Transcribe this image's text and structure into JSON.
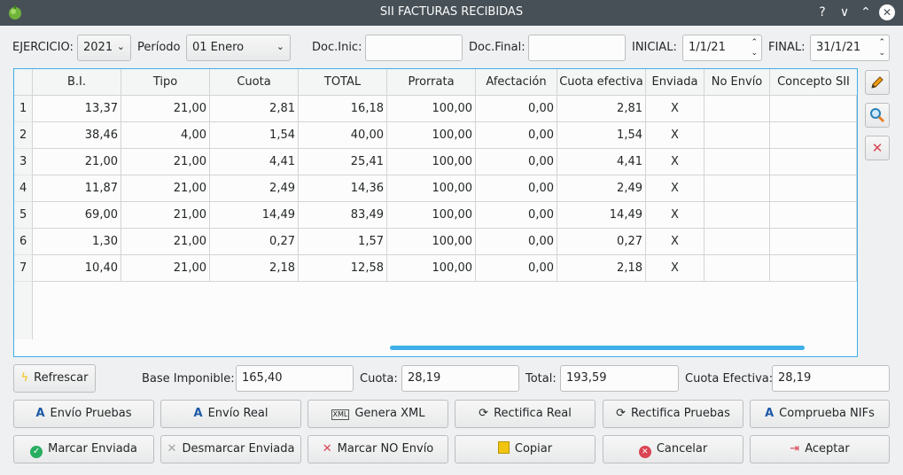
{
  "window": {
    "title": "SII FACTURAS RECIBIDAS",
    "help": "?",
    "minimize": "∨",
    "maximize": "⌃",
    "close": "✕"
  },
  "filters": {
    "ejercicio_label": "EJERCICIO:",
    "ejercicio_value": "2021",
    "periodo_label": "Período",
    "periodo_value": "01 Enero",
    "doc_inic_label": "Doc.Inic:",
    "doc_inic_value": "",
    "doc_final_label": "Doc.Final:",
    "doc_final_value": "",
    "inicial_label": "INICIAL:",
    "inicial_value": "1/1/21",
    "final_label": "FINAL:",
    "final_value": "31/1/21"
  },
  "table": {
    "columns": [
      "B.I.",
      "Tipo",
      "Cuota",
      "TOTAL",
      "Prorrata",
      "Afectación",
      "Cuota efectiva",
      "Enviada",
      "No Envío",
      "Concepto SII"
    ],
    "rows": [
      {
        "n": "1",
        "bi": "13,37",
        "tipo": "21,00",
        "cuota": "2,81",
        "total": "16,18",
        "prorrata": "100,00",
        "afectacion": "0,00",
        "cuota_efectiva": "2,81",
        "enviada": "X",
        "no_envio": "",
        "concepto": ""
      },
      {
        "n": "2",
        "bi": "38,46",
        "tipo": "4,00",
        "cuota": "1,54",
        "total": "40,00",
        "prorrata": "100,00",
        "afectacion": "0,00",
        "cuota_efectiva": "1,54",
        "enviada": "X",
        "no_envio": "",
        "concepto": ""
      },
      {
        "n": "3",
        "bi": "21,00",
        "tipo": "21,00",
        "cuota": "4,41",
        "total": "25,41",
        "prorrata": "100,00",
        "afectacion": "0,00",
        "cuota_efectiva": "4,41",
        "enviada": "X",
        "no_envio": "",
        "concepto": ""
      },
      {
        "n": "4",
        "bi": "11,87",
        "tipo": "21,00",
        "cuota": "2,49",
        "total": "14,36",
        "prorrata": "100,00",
        "afectacion": "0,00",
        "cuota_efectiva": "2,49",
        "enviada": "X",
        "no_envio": "",
        "concepto": ""
      },
      {
        "n": "5",
        "bi": "69,00",
        "tipo": "21,00",
        "cuota": "14,49",
        "total": "83,49",
        "prorrata": "100,00",
        "afectacion": "0,00",
        "cuota_efectiva": "14,49",
        "enviada": "X",
        "no_envio": "",
        "concepto": ""
      },
      {
        "n": "6",
        "bi": "1,30",
        "tipo": "21,00",
        "cuota": "0,27",
        "total": "1,57",
        "prorrata": "100,00",
        "afectacion": "0,00",
        "cuota_efectiva": "0,27",
        "enviada": "X",
        "no_envio": "",
        "concepto": ""
      },
      {
        "n": "7",
        "bi": "10,40",
        "tipo": "21,00",
        "cuota": "2,18",
        "total": "12,58",
        "prorrata": "100,00",
        "afectacion": "0,00",
        "cuota_efectiva": "2,18",
        "enviada": "X",
        "no_envio": "",
        "concepto": ""
      }
    ]
  },
  "side_tools": [
    {
      "icon": "pencil-icon",
      "glyph": "✎"
    },
    {
      "icon": "magnifier-icon",
      "glyph": "🔍"
    },
    {
      "icon": "delete-x-icon",
      "glyph": "✕"
    }
  ],
  "totals": {
    "refrescar": "Refrescar",
    "base_label": "Base Imponible:",
    "base_value": "165,40",
    "cuota_label": "Cuota:",
    "cuota_value": "28,19",
    "total_label": "Total:",
    "total_value": "193,59",
    "cuota_efectiva_label": "Cuota Efectiva:",
    "cuota_efectiva_value": "28,19"
  },
  "actions_row1": [
    "Envío Pruebas",
    "Envío Real",
    "Genera XML",
    "Rectifica Real",
    "Rectifica Pruebas",
    "Comprueba NIFs"
  ],
  "actions_row2": [
    "Marcar Enviada",
    "Desmarcar Enviada",
    "Marcar NO Envío",
    "Copiar",
    "Cancelar",
    "Aceptar"
  ],
  "colors": {
    "titlebar": "#475057",
    "accent": "#3daee9",
    "delete": "#da4453",
    "ok_green": "#27ae60"
  }
}
